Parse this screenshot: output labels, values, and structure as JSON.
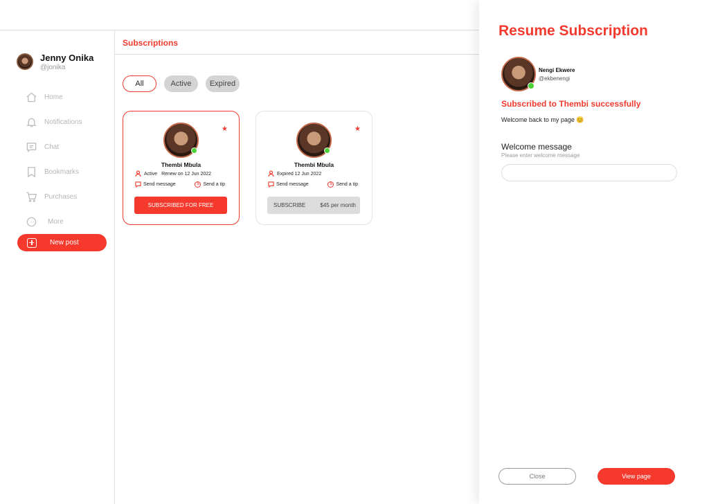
{
  "colors": {
    "accent": "#f23a2e",
    "online": "#4cd137",
    "chip_grey": "#d4d4d4"
  },
  "sidebar": {
    "user": {
      "name": "Jenny Onika",
      "handle": "@jonika"
    },
    "nav": [
      {
        "label": "Home",
        "icon": "home-icon"
      },
      {
        "label": "Notifications",
        "icon": "bell-icon"
      },
      {
        "label": "Chat",
        "icon": "chat-icon"
      },
      {
        "label": "Bookmarks",
        "icon": "bookmark-icon"
      },
      {
        "label": "Purchases",
        "icon": "cart-icon"
      },
      {
        "label": "More",
        "icon": "more-icon"
      }
    ],
    "new_post": "New post"
  },
  "main": {
    "title": "Subscriptions",
    "filters": [
      "All",
      "Active",
      "Expired"
    ],
    "cards": [
      {
        "name": "Thembi Mbula",
        "status": "Active",
        "renew": "Renew on 12 Jun 2022",
        "send_message": "Send message",
        "send_tip": "Send a tip",
        "button": "SUBSCRIBED FOR FREE"
      },
      {
        "name": "Thembi Mbula",
        "status": "Expired 12 Jun 2022",
        "send_message": "Send message",
        "send_tip": "Send a tip",
        "button": "SUBSCRIBE",
        "price": "$45 per month"
      }
    ]
  },
  "panel": {
    "title": "Resume Subscription",
    "user": {
      "name": "Nengi Ekwere",
      "handle": "@ekbenengi"
    },
    "success": "Subscribed to Thembi successfully",
    "welcome_line": "Welcome back to my page  😊",
    "welcome_label": "Welcome message",
    "welcome_hint": "Please enter welcome message",
    "welcome_value": "",
    "close": "Close",
    "view_page": "View page"
  }
}
